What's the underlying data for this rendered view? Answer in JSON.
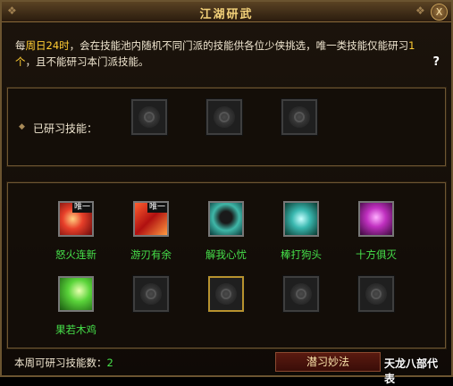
{
  "window": {
    "title": "江湖研武",
    "close_glyph": "X",
    "help_glyph": "?"
  },
  "description": {
    "part1": "每",
    "hl1": "周日24时",
    "part2": "，会在技能池内随机不同门派的技能供各位少侠挑选，唯一类技能仅能研习",
    "hl2": "1个",
    "part3": "，且不能研习本门派技能。"
  },
  "studied": {
    "label": "已研习技能：",
    "slots": 3
  },
  "skills": [
    {
      "name": "怒火连新",
      "badge": "唯一",
      "icon": "flame-fist-icon"
    },
    {
      "name": "游刃有余",
      "badge": "唯一",
      "icon": "blade-flurry-icon"
    },
    {
      "name": "解我心忧",
      "badge": "",
      "icon": "healing-figure-icon"
    },
    {
      "name": "棒打狗头",
      "badge": "",
      "icon": "staff-strike-icon"
    },
    {
      "name": "十方俱灭",
      "badge": "",
      "icon": "demon-skull-icon"
    },
    {
      "name": "果若木鸡",
      "badge": "",
      "icon": "green-burst-icon"
    }
  ],
  "footer": {
    "count_label": "本周可研习技能数：",
    "count_value": "2",
    "learn_button": "潜习妙法",
    "logo": "天龙八部代表"
  },
  "colors": {
    "gold_title": "#f4d27a",
    "skill_name_green": "#46e04a",
    "highlight_yellow": "#ffcc33"
  }
}
